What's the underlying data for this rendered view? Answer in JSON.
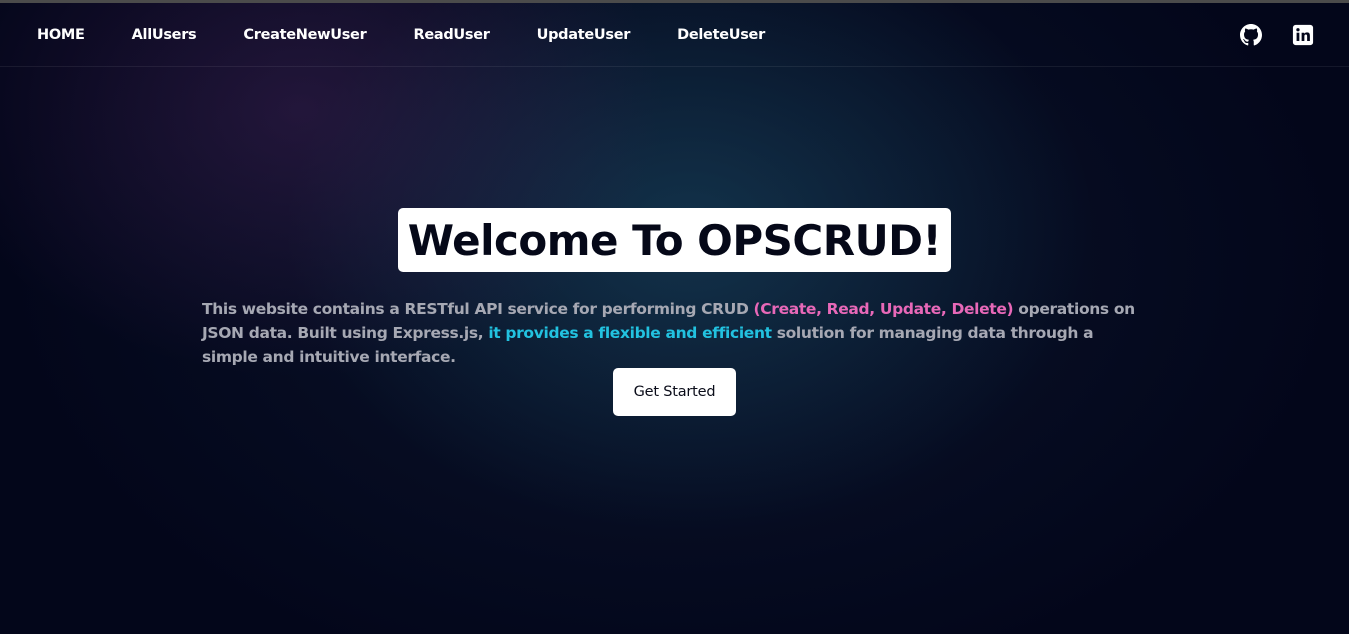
{
  "nav": {
    "links": [
      {
        "label": "HOME"
      },
      {
        "label": "AllUsers"
      },
      {
        "label": "CreateNewUser"
      },
      {
        "label": "ReadUser"
      },
      {
        "label": "UpdateUser"
      },
      {
        "label": "DeleteUser"
      }
    ],
    "icons": [
      "github-icon",
      "linkedin-icon"
    ]
  },
  "hero": {
    "title": "Welcome To OPSCRUD!",
    "description": {
      "part1": "This website contains a RESTful API service for performing CRUD ",
      "crud_highlight": "(Create, Read, Update, Delete)",
      "part2": " operations on JSON data. Built using Express.js, ",
      "flex_highlight": "it provides a flexible and efficient",
      "part3": " solution for managing data through a simple and intuitive interface."
    },
    "cta_label": "Get Started"
  },
  "colors": {
    "background": "#03061a",
    "highlight_pink": "#e868b8",
    "highlight_cyan": "#22c2e0",
    "body_text": "#a6a8b3",
    "title_box": "#ffffff"
  }
}
